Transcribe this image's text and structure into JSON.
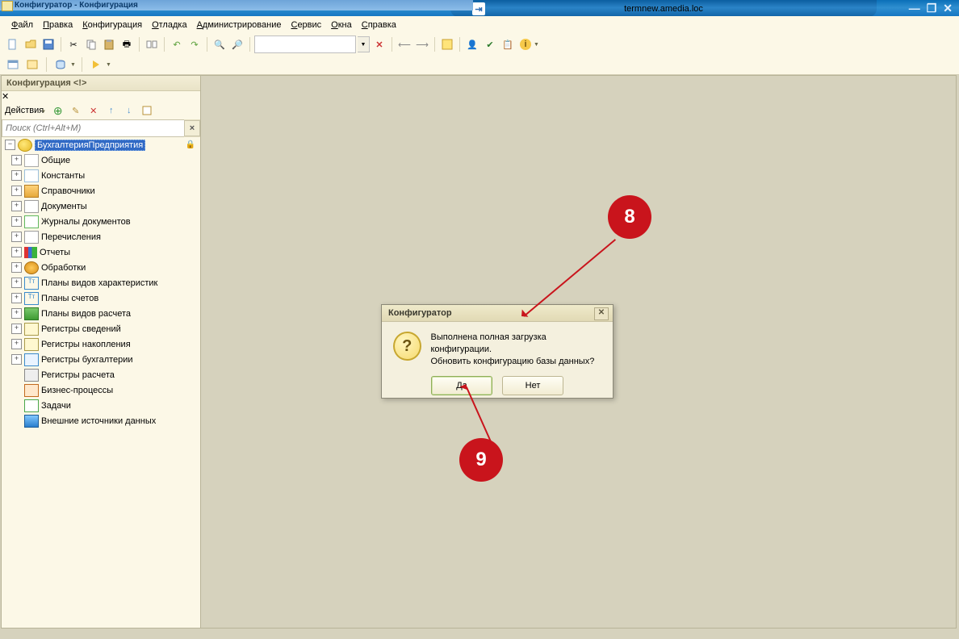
{
  "os": {
    "remote_title": "termnew.amedia.loc"
  },
  "window": {
    "title": "Конфигуратор - Конфигурация"
  },
  "menu": {
    "file": "Файл",
    "edit": "Правка",
    "config": "Конфигурация",
    "debug": "Отладка",
    "admin": "Администрирование",
    "service": "Сервис",
    "windows": "Окна",
    "help": "Справка"
  },
  "panel": {
    "title": "Конфигурация <!>",
    "actions_label": "Действия",
    "search_placeholder": "Поиск (Ctrl+Alt+M)",
    "root": "БухгалтерияПредприятия",
    "nodes": [
      {
        "label": "Общие",
        "icon": "dots",
        "expandable": true
      },
      {
        "label": "Константы",
        "icon": "grid",
        "expandable": true
      },
      {
        "label": "Справочники",
        "icon": "cube",
        "expandable": true
      },
      {
        "label": "Документы",
        "icon": "doc",
        "expandable": true
      },
      {
        "label": "Журналы документов",
        "icon": "pivot",
        "expandable": true
      },
      {
        "label": "Перечисления",
        "icon": "list",
        "expandable": true
      },
      {
        "label": "Отчеты",
        "icon": "bar",
        "expandable": true
      },
      {
        "label": "Обработки",
        "icon": "gear",
        "expandable": true
      },
      {
        "label": "Планы видов характеристик",
        "icon": "tt",
        "expandable": true
      },
      {
        "label": "Планы счетов",
        "icon": "tt",
        "expandable": true
      },
      {
        "label": "Планы видов расчета",
        "icon": "stack",
        "expandable": true
      },
      {
        "label": "Регистры сведений",
        "icon": "reg",
        "expandable": true
      },
      {
        "label": "Регистры накопления",
        "icon": "reg",
        "expandable": true
      },
      {
        "label": "Регистры бухгалтерии",
        "icon": "regT",
        "expandable": true
      },
      {
        "label": "Регистры расчета",
        "icon": "calc",
        "expandable": false
      },
      {
        "label": "Бизнес-процессы",
        "icon": "flow",
        "expandable": false
      },
      {
        "label": "Задачи",
        "icon": "task",
        "expandable": false
      },
      {
        "label": "Внешние источники данных",
        "icon": "ext",
        "expandable": false
      }
    ]
  },
  "dialog": {
    "title": "Конфигуратор",
    "line1": "Выполнена полная загрузка конфигурации.",
    "line2": "Обновить конфигурацию базы данных?",
    "yes": "Да",
    "no": "Нет"
  },
  "callouts": {
    "n8": "8",
    "n9": "9"
  }
}
